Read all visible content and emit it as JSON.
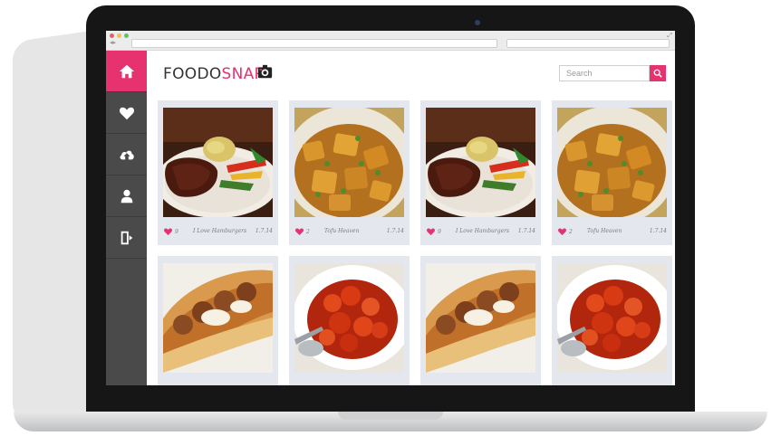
{
  "browser": {
    "address": "",
    "search": ""
  },
  "sidebar": {
    "items": [
      {
        "icon": "home-icon",
        "active": true
      },
      {
        "icon": "heart-icon",
        "active": false
      },
      {
        "icon": "cloud-upload-icon",
        "active": false
      },
      {
        "icon": "user-icon",
        "active": false
      },
      {
        "icon": "logout-icon",
        "active": false
      }
    ]
  },
  "header": {
    "logo_part1": "FOODO",
    "logo_part2": "SNAP",
    "search_placeholder": "Search"
  },
  "colors": {
    "accent": "#e6326e",
    "sidebar": "#4a4a4a",
    "card": "#e4e8ee"
  },
  "cards": [
    {
      "image": "steak-plate",
      "likes": "9",
      "name": "I Love Hamburgers",
      "date": "1.7.14"
    },
    {
      "image": "potato-curry",
      "likes": "2",
      "name": "Tofu Heaven",
      "date": "1.7.14"
    },
    {
      "image": "steak-plate",
      "likes": "9",
      "name": "I Love Hamburgers",
      "date": "1.7.14"
    },
    {
      "image": "potato-curry",
      "likes": "2",
      "name": "Tofu Heaven",
      "date": "1.7.14"
    },
    {
      "image": "meatball-sub",
      "likes": "",
      "name": "",
      "date": ""
    },
    {
      "image": "sweet-sour-plate",
      "likes": "",
      "name": "",
      "date": ""
    },
    {
      "image": "meatball-sub",
      "likes": "",
      "name": "",
      "date": ""
    },
    {
      "image": "sweet-sour-plate",
      "likes": "",
      "name": "",
      "date": ""
    }
  ]
}
